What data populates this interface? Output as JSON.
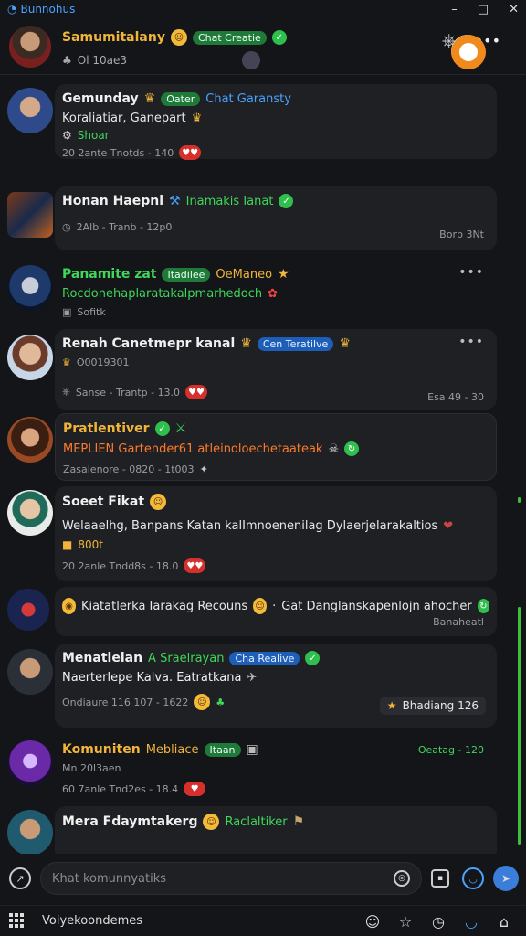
{
  "app": {
    "title": "Bunnohus"
  },
  "header": {
    "name": "Samumitalany",
    "tag": "Chat Creatie",
    "subtitle": "Ol 10ae3"
  },
  "messages": [
    {
      "name": "Gemunday",
      "name_color": "#f0f0f0",
      "tag": "Oater",
      "tag2": "Chat Garansty",
      "text": "Koraliatiar, Ganepart",
      "text_color": "#f0f0f0",
      "sub": "Shoar",
      "meta": "20 2ante Tnotds - 140"
    },
    {
      "name": "Honan Haepni",
      "name_color": "#f0b53a",
      "extra": "Inamakis Ianat",
      "text": "",
      "meta": "2Alb - Tranb - 12p0",
      "meta_right": "Borb 3Nt"
    },
    {
      "name": "Panamite zat",
      "name_color": "#3fd65a",
      "tag": "Itadilee",
      "extra": "OeManeo",
      "text": "Rocdonehaplaratakalpmarhedoch",
      "text_color": "#3fd65a",
      "meta": "Sofitk"
    },
    {
      "name": "Renah Canetmepr kanal",
      "name_color": "#f0f0f0",
      "tag": "Cen Teratilve",
      "sub": "O0019301",
      "meta": "Sanse - Trantp - 13.0",
      "meta_right": "Esa 49 - 30"
    },
    {
      "name": "Pratlentiver",
      "name_color": "#f0b53a",
      "text": "MEPLIEN Gartender61 atleinoloechetaateak",
      "text_color": "#ff7a2e",
      "meta": "Zasalenore - 0820 - 1t003"
    },
    {
      "name": "Soeet Fikat",
      "name_color": "#f0f0f0",
      "text": "Welaaelhg, Banpans Katan kalImnoenenilag Dylaerjelarakaltios",
      "text_color": "#f0f0f0",
      "sub": "800t",
      "meta": "20 2anle Tndd8s - 18.0"
    },
    {
      "name": "Kiatatlerka Iarakag Recouns",
      "name_color": "#f0f0f0",
      "text": "Gat Danglanskapenlojn ahocher",
      "meta_right": "Banaheatl"
    },
    {
      "name": "Menatlelan",
      "name_color": "#f0f0f0",
      "extra": "A Sraelrayan",
      "tag": "Cha Realive",
      "text": "Naerterlepe Kalva. Eatratkana",
      "text_color": "#f0f0f0",
      "meta": "Ondiaure 116 107 - 1622",
      "chip": "Bhadiang 126"
    },
    {
      "name": "Komuniten",
      "name_color": "#f0b53a",
      "extra": "Mebliace",
      "tag": "Itaan",
      "sub": "Mn 20l3aen",
      "meta": "60 7anle Tnd2es - 18.4",
      "meta_right": "Oeatag - 120"
    },
    {
      "name": "Mera Fdaymtakerg",
      "name_color": "#f0f0f0",
      "extra": "Raclaltiker",
      "text": ""
    }
  ],
  "composer": {
    "placeholder": "Khat komunnyatiks"
  },
  "bottombar": {
    "label": "Voiyekoondemes"
  },
  "colors": {
    "accent_blue": "#4aa3ff",
    "accent_green": "#3fd65a",
    "accent_orange": "#f0b53a",
    "bg": "#141518",
    "bubble": "#1e2024"
  }
}
